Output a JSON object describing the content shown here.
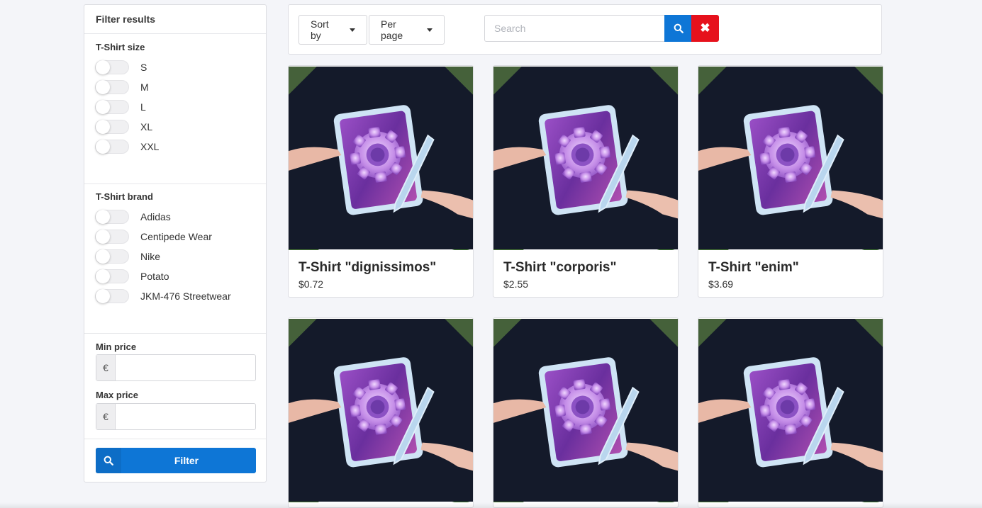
{
  "sidebar": {
    "title": "Filter results",
    "size_group": {
      "title": "T-Shirt size",
      "options": [
        "S",
        "M",
        "L",
        "XL",
        "XXL"
      ]
    },
    "brand_group": {
      "title": "T-Shirt brand",
      "options": [
        "Adidas",
        "Centipede Wear",
        "Nike",
        "Potato",
        "JKM-476 Streetwear"
      ]
    },
    "min_price": {
      "label": "Min price",
      "currency": "€",
      "value": ""
    },
    "max_price": {
      "label": "Max price",
      "currency": "€",
      "value": ""
    },
    "filter_button": "Filter"
  },
  "toolbar": {
    "sort_label": "Sort by",
    "per_page_label": "Per page",
    "search_placeholder": "Search",
    "search_value": "",
    "clear_symbol": "✖"
  },
  "products": [
    {
      "name": "T-Shirt \"dignissimos\"",
      "price": "$0.72"
    },
    {
      "name": "T-Shirt \"corporis\"",
      "price": "$2.55"
    },
    {
      "name": "T-Shirt \"enim\"",
      "price": "$3.69"
    },
    {
      "name": "",
      "price": ""
    },
    {
      "name": "",
      "price": ""
    },
    {
      "name": "",
      "price": ""
    }
  ],
  "colors": {
    "primary": "#0e76d6",
    "danger": "#e6111c",
    "background": "#f4f5f9"
  },
  "icons": {
    "search_button": "search-icon",
    "filter_button": "search-icon",
    "clear_button": "close-icon"
  }
}
